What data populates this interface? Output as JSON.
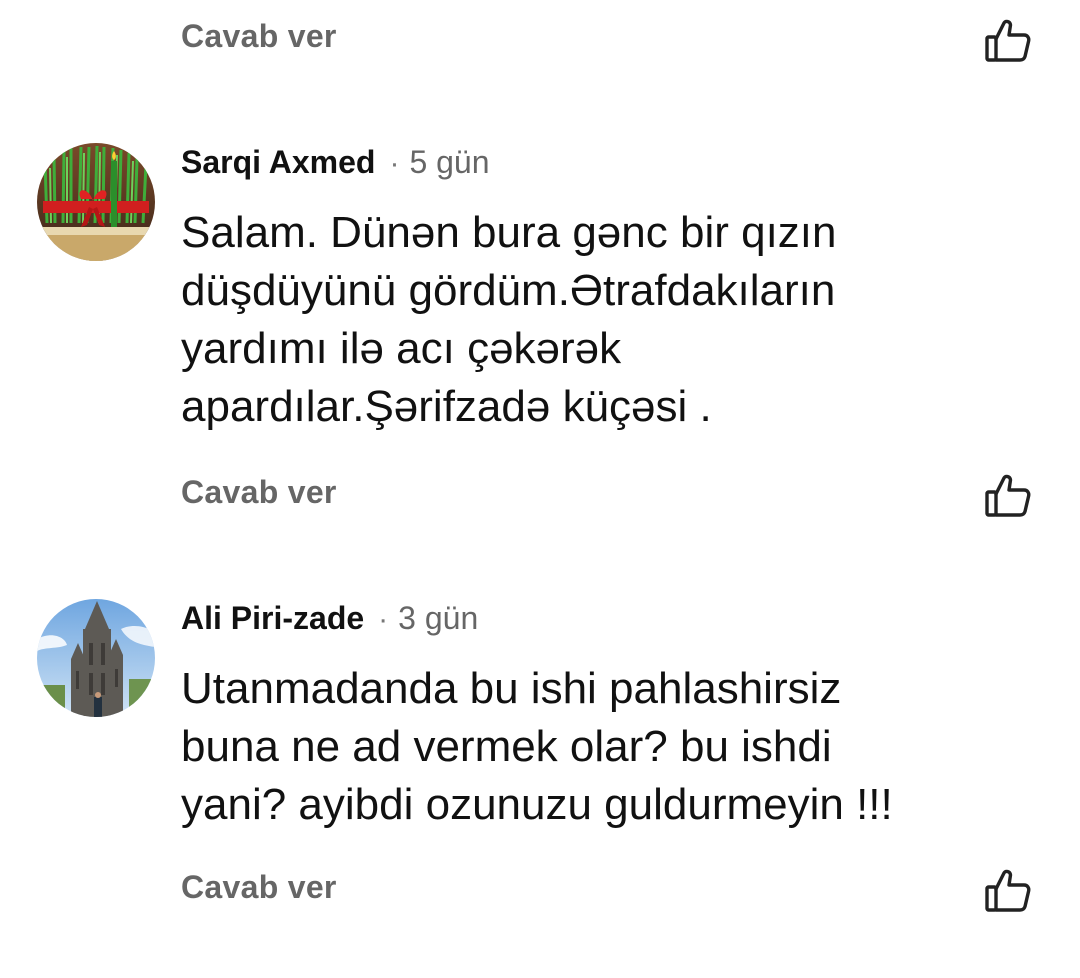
{
  "top_reply": {
    "reply_label": "Cavab ver",
    "like_icon": "thumbs-up-icon"
  },
  "comments": [
    {
      "author": "Sarqi Axmed",
      "separator": "·",
      "time": "5 gün",
      "avatar": "avatar-novruz-grass",
      "lines": [
        "Salam. Dünən bura gənc bir qızın",
        "düşdüyünü gördüm.Ətrafdakıların",
        "yardımı ilə acı çəkərək",
        "apardılar.Şərifzadə küçəsi ."
      ],
      "reply_label": "Cavab ver",
      "like_icon": "thumbs-up-icon"
    },
    {
      "author": "Ali Piri-zade",
      "separator": "·",
      "time": "3 gün",
      "avatar": "avatar-cathedral",
      "lines": [
        "Utanmadanda bu ishi pahlashirsiz",
        "buna ne ad vermek olar? bu ishdi",
        "yani? ayibdi ozunuzu guldurmeyin !!!"
      ],
      "reply_label": "Cavab ver",
      "like_icon": "thumbs-up-icon"
    }
  ],
  "colors": {
    "text": "#111111",
    "secondary": "#666666",
    "background": "#ffffff"
  }
}
